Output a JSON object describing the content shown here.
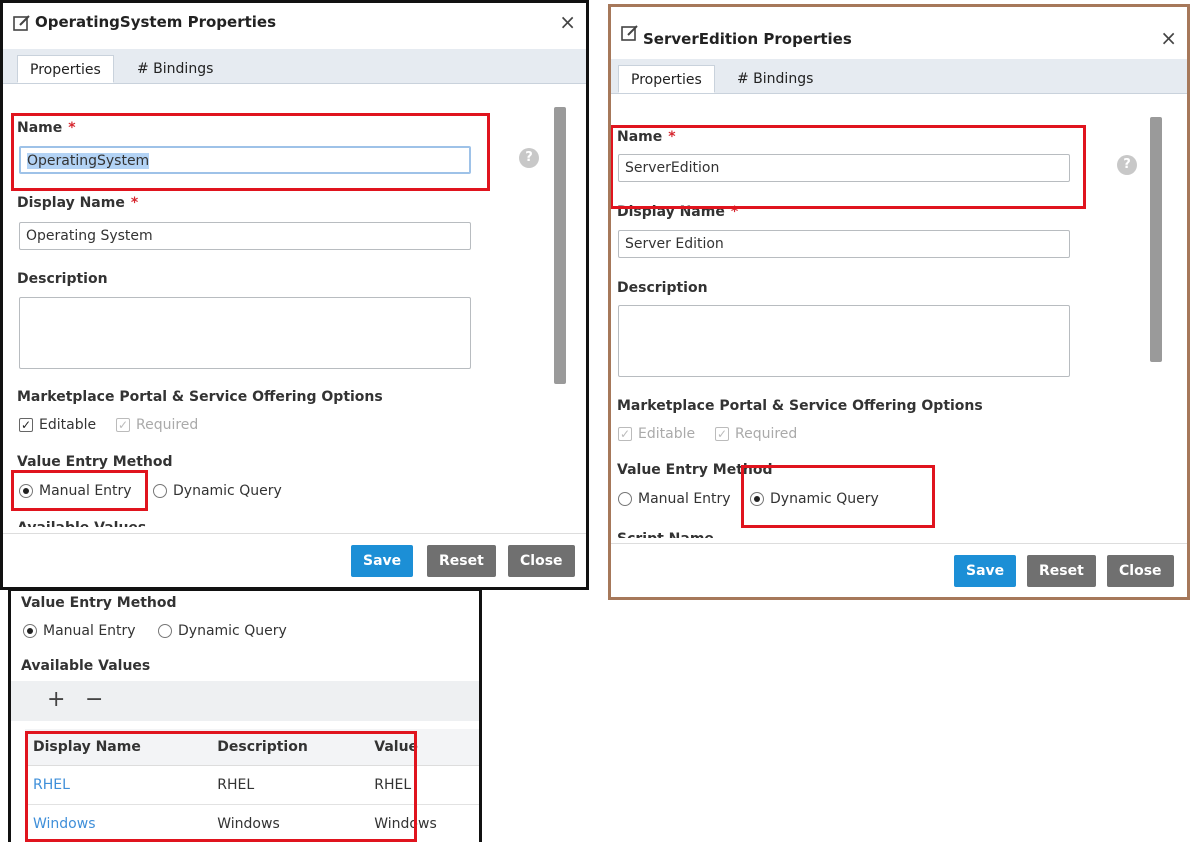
{
  "dialog1": {
    "title": "OperatingSystem Properties",
    "close_glyph": "×",
    "tabs": [
      "Properties",
      "# Bindings"
    ],
    "name_label": "Name",
    "required_mark": "*",
    "name_value": "OperatingSystem",
    "display_name_label": "Display Name",
    "display_name_value": "Operating System",
    "description_label": "Description",
    "description_value": "",
    "options_heading": "Marketplace Portal & Service Offering Options",
    "editable_label": "Editable",
    "editable_checked": true,
    "required_label": "Required",
    "required_checked": true,
    "entry_method_label": "Value Entry Method",
    "manual_entry_label": "Manual Entry",
    "dynamic_query_label": "Dynamic Query",
    "selected_method": "Manual Entry",
    "cutoff_label": "Available Values",
    "help_glyph": "?",
    "buttons": {
      "save": "Save",
      "reset": "Reset",
      "close": "Close"
    }
  },
  "dialog2": {
    "title": "ServerEdition Properties",
    "close_glyph": "×",
    "tabs": [
      "Properties",
      "# Bindings"
    ],
    "name_label": "Name",
    "required_mark": "*",
    "name_value": "ServerEdition",
    "display_name_label": "Display Name",
    "display_name_value": "Server Edition",
    "description_label": "Description",
    "description_value": "",
    "options_heading": "Marketplace Portal & Service Offering Options",
    "editable_label": "Editable",
    "editable_checked": true,
    "required_label": "Required",
    "required_checked": true,
    "entry_method_label": "Value Entry Method",
    "manual_entry_label": "Manual Entry",
    "dynamic_query_label": "Dynamic Query",
    "selected_method": "Dynamic Query",
    "cutoff_label": "Script Name",
    "help_glyph": "?",
    "buttons": {
      "save": "Save",
      "reset": "Reset",
      "close": "Close"
    }
  },
  "panel3": {
    "entry_method_label": "Value Entry Method",
    "manual_entry_label": "Manual Entry",
    "dynamic_query_label": "Dynamic Query",
    "selected_method": "Manual Entry",
    "available_values_label": "Available Values",
    "add_glyph": "+",
    "remove_glyph": "−",
    "table": {
      "headers": [
        "Display Name",
        "Description",
        "Value"
      ],
      "rows": [
        [
          "RHEL",
          "RHEL",
          "RHEL"
        ],
        [
          "Windows",
          "Windows",
          "Windows"
        ]
      ]
    }
  },
  "colors": {
    "accent": "#1c8fd6",
    "highlight_box": "#e0141e",
    "link": "#3f8fd9",
    "dialog2_border": "#a6785a"
  },
  "icons": [
    "edit-icon",
    "close-icon",
    "help-icon",
    "add-icon",
    "remove-icon"
  ]
}
